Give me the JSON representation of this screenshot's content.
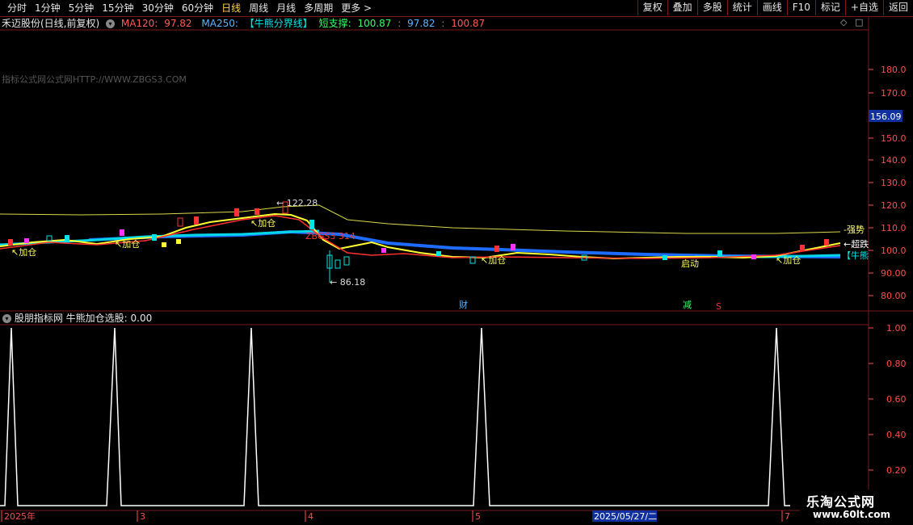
{
  "toolbar": {
    "periods": [
      "分时",
      "1分钟",
      "5分钟",
      "15分钟",
      "30分钟",
      "60分钟",
      "日线",
      "周线",
      "月线",
      "多周期",
      "更多 >"
    ],
    "active_period": "日线",
    "tools": [
      "复权",
      "叠加",
      "多股",
      "统计",
      "画线",
      "F10",
      "标记",
      "+自选",
      "返回"
    ]
  },
  "main_panel": {
    "stock_label": "禾迈股份(日线,前复权)",
    "ma120_label": "MA120:",
    "ma120_value": "97.82",
    "ma250_label": "MA250:",
    "bull_bear_label": "【牛熊分界线】",
    "support_label": "短支撑:",
    "support_value1": "100.87",
    "support_value2": "97.82",
    "support_value3": "100.87",
    "watermark": "指标公式网公式网HTTP://WWW.ZBGS3.COM",
    "right_ticks": [
      "180.0",
      "170.0",
      "150.0",
      "140.0",
      "130.0",
      "120.0",
      "110.0",
      "100.0",
      "90.00",
      "80.00"
    ],
    "price_tag": "156.09",
    "annotations": {
      "high": "122.28",
      "low": "86.18",
      "zbg": "ZBGS3",
      "zbg_num": "314",
      "jiacang": "加仓",
      "qidong": "启动",
      "qiangshi": "强势",
      "chaodi": "←超跌",
      "niuxiong": "【牛熊",
      "cai": "财",
      "jian": "减",
      "s": "S"
    }
  },
  "sub_panel": {
    "indicator_name": "股朋指标网",
    "formula_label": "牛熊加仓选股:",
    "formula_value": "0.00",
    "right_ticks": [
      "1.00",
      "0.80",
      "0.60",
      "0.40",
      "0.20"
    ]
  },
  "date_axis": {
    "year_label": "2025年",
    "months": [
      "3",
      "4",
      "5",
      "7"
    ],
    "cursor_date": "2025/05/27/二"
  },
  "logo": {
    "line1": "乐淘公式网",
    "line2": "www.60lt.com"
  },
  "colors": {
    "up": "#ff3333",
    "down": "#00e5e5",
    "ma_yellow": "#ffff33",
    "ma_blue": "#1e6cff",
    "grid": "#7a1a1a",
    "accent": "#ffd24a"
  }
}
